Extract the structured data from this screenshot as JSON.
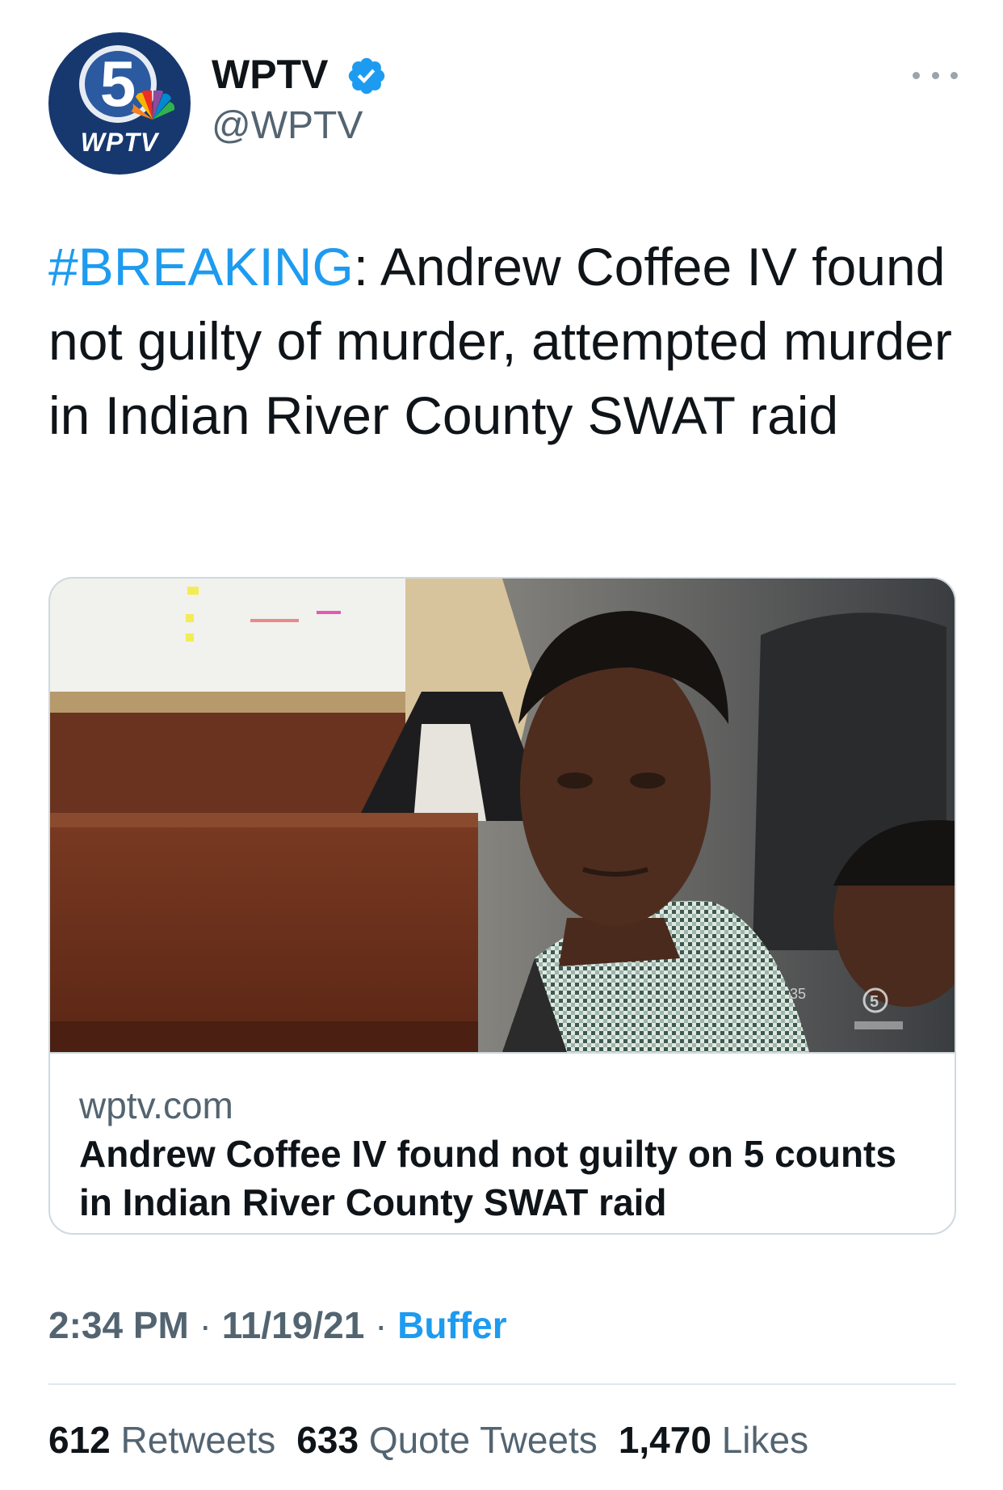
{
  "author": {
    "display_name": "WPTV",
    "handle": "@WPTV",
    "avatar_text": "5",
    "avatar_brand": "WPTV",
    "verified_icon": "verified-badge-icon",
    "more_icon": "more-options-icon"
  },
  "tweet": {
    "hashtag": "#BREAKING",
    "text": ": Andrew Coffee IV found not guilty of murder, attempted murder in Indian River County SWAT raid"
  },
  "card": {
    "image_overlay_logo": "5",
    "domain": "wptv.com",
    "title": "Andrew Coffee IV found not guilty on 5 counts in Indian River County SWAT raid"
  },
  "meta": {
    "time": "2:34 PM",
    "separator": "·",
    "date": "11/19/21",
    "source": "Buffer"
  },
  "stats": {
    "retweets_count": "612",
    "retweets_label": "Retweets",
    "quote_tweets_count": "633",
    "quote_tweets_label": "Quote Tweets",
    "likes_count": "1,470",
    "likes_label": "Likes"
  },
  "colors": {
    "link": "#1d9bf0",
    "secondary_text": "#536471",
    "primary_text": "#0f1419",
    "avatar_bg": "#16386e"
  }
}
